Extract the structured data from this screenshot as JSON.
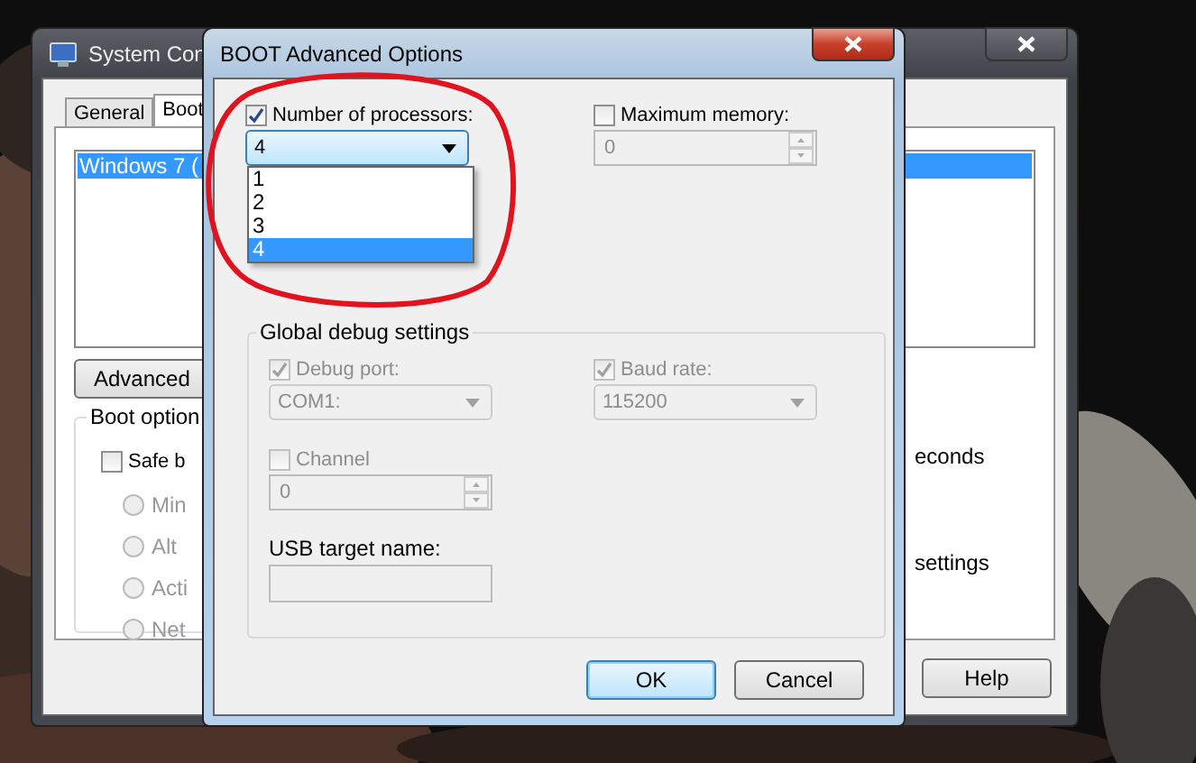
{
  "back_window": {
    "title": "System Con",
    "tabs": [
      {
        "label": "General",
        "selected": false
      },
      {
        "label": "Boot",
        "selected": true
      }
    ],
    "os_list": [
      {
        "label": "Windows 7 (",
        "selected": true
      }
    ],
    "advanced_button": "Advanced",
    "boot_options": {
      "title": "Boot option",
      "safe_boot": {
        "label": "Safe b",
        "checked": false
      },
      "modes": [
        {
          "label": "Min",
          "selected": false
        },
        {
          "label": "Alt",
          "selected": false
        },
        {
          "label": "Acti",
          "selected": false
        },
        {
          "label": "Net",
          "selected": false
        }
      ]
    },
    "timeout_text": "econds",
    "permanent_text": "settings",
    "buttons": [
      "Help"
    ]
  },
  "dialog": {
    "title": "BOOT Advanced Options",
    "processors": {
      "label": "Number of processors:",
      "checked": true,
      "disabled": false,
      "value": "4",
      "expanded": true,
      "options": [
        {
          "label": "1",
          "selected": false
        },
        {
          "label": "2",
          "selected": false
        },
        {
          "label": "3",
          "selected": false
        },
        {
          "label": "4",
          "selected": true
        }
      ]
    },
    "max_memory": {
      "label": "Maximum memory:",
      "checked": false,
      "disabled": false,
      "value": "0"
    },
    "debug": {
      "title": "Global debug settings",
      "debug_port": {
        "label": "Debug port:",
        "checked": true,
        "disabled": true,
        "value": "COM1:"
      },
      "baud_rate": {
        "label": "Baud rate:",
        "checked": true,
        "disabled": true,
        "value": "115200"
      },
      "channel": {
        "label": "Channel",
        "checked": false,
        "disabled": true,
        "value": "0"
      },
      "usb_target": {
        "label": "USB target name:"
      }
    },
    "buttons": [
      {
        "label": "OK",
        "default": true
      },
      {
        "label": "Cancel",
        "default": false
      }
    ]
  },
  "annotation": {
    "kind": "ellipse"
  }
}
